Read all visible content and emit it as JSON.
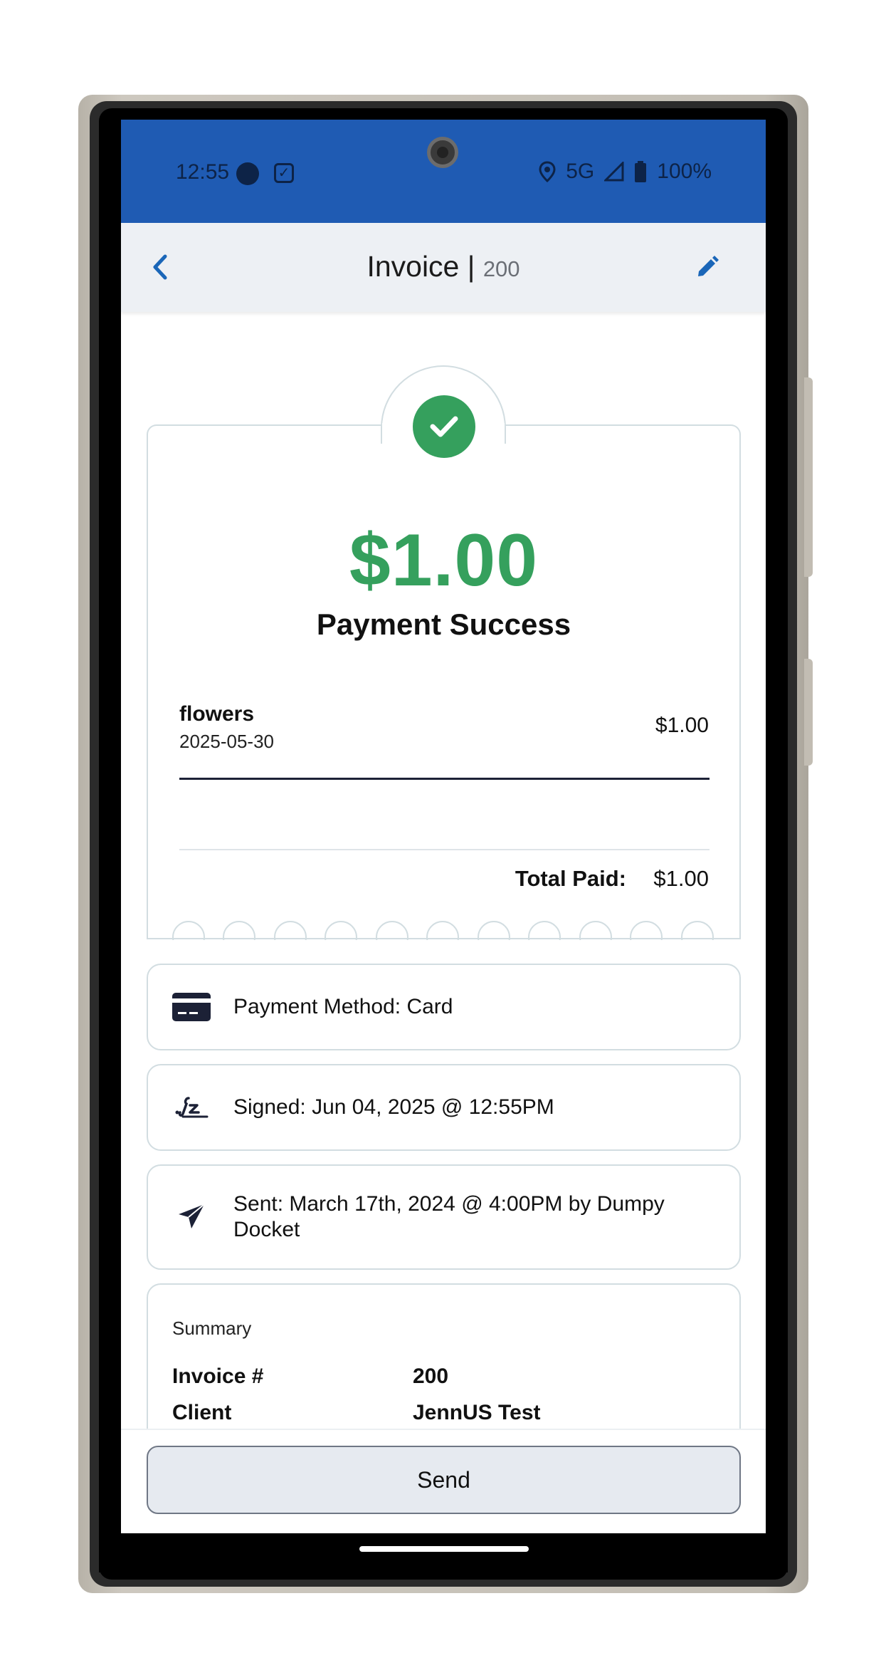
{
  "status_bar": {
    "time": "12:55",
    "network": "5G",
    "battery": "100%"
  },
  "header": {
    "title": "Invoice |",
    "invoice_number": "200"
  },
  "receipt": {
    "amount": "$1.00",
    "status": "Payment Success",
    "line_item": {
      "name": "flowers",
      "date": "2025-05-30",
      "price": "$1.00"
    },
    "total_label": "Total Paid:",
    "total_value": "$1.00"
  },
  "details": {
    "payment_method": "Payment Method: Card",
    "signed": "Signed: Jun 04, 2025 @ 12:55PM",
    "sent": "Sent: March 17th, 2024 @ 4:00PM by Dumpy Docket"
  },
  "summary": {
    "title": "Summary",
    "rows": [
      {
        "key": "Invoice #",
        "value": "200"
      },
      {
        "key": "Client",
        "value": "JennUS Test"
      }
    ]
  },
  "actions": {
    "send_label": "Send"
  },
  "colors": {
    "status_bar": "#1f5bb3",
    "success_green": "#35a05d",
    "accent_blue": "#1a66b8",
    "card_border": "#d2dde1"
  },
  "icons": {
    "back": "chevron-left-icon",
    "edit": "pencil-icon",
    "success": "checkmark-icon",
    "payment": "credit-card-icon",
    "signed": "signature-icon",
    "sent": "paper-plane-icon"
  }
}
